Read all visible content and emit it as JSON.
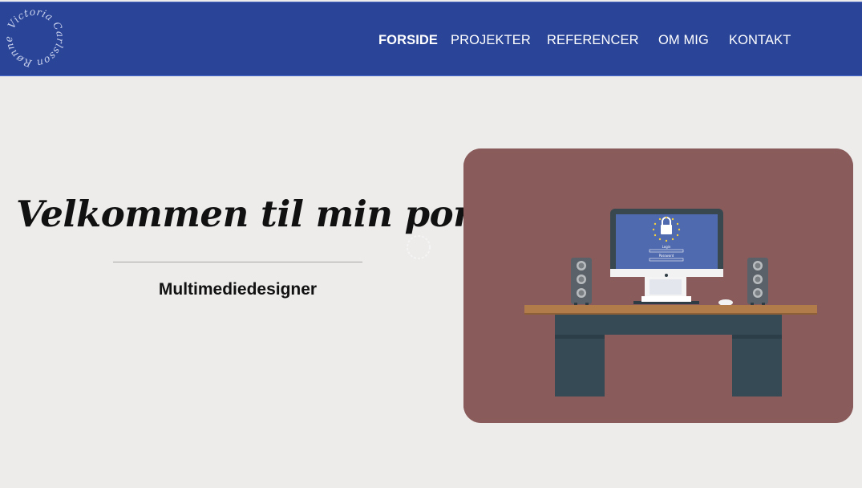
{
  "logo": {
    "text": "Victoria Carlsson Rønne",
    "icon": "circular-signature-logo"
  },
  "nav": {
    "items": [
      {
        "label": "FORSIDE",
        "active": true
      },
      {
        "label": "PROJEKTER",
        "active": false
      },
      {
        "label": "REFERENCER",
        "active": false
      },
      {
        "label": "OM MIG",
        "active": false
      },
      {
        "label": "KONTAKT",
        "active": false
      }
    ]
  },
  "hero": {
    "title": "Velkommen til min portfolio",
    "subtitle": "Multimediedesigner"
  },
  "illustration": {
    "name": "desk-computer-illustration",
    "screen_login_label": "Login",
    "screen_password_label": "Password"
  },
  "colors": {
    "header_bg": "#2a4598",
    "page_bg": "#edeceb",
    "image_bg": "#8a5b5b",
    "desk_top": "#b27c4a",
    "desk_legs": "#354a55"
  }
}
